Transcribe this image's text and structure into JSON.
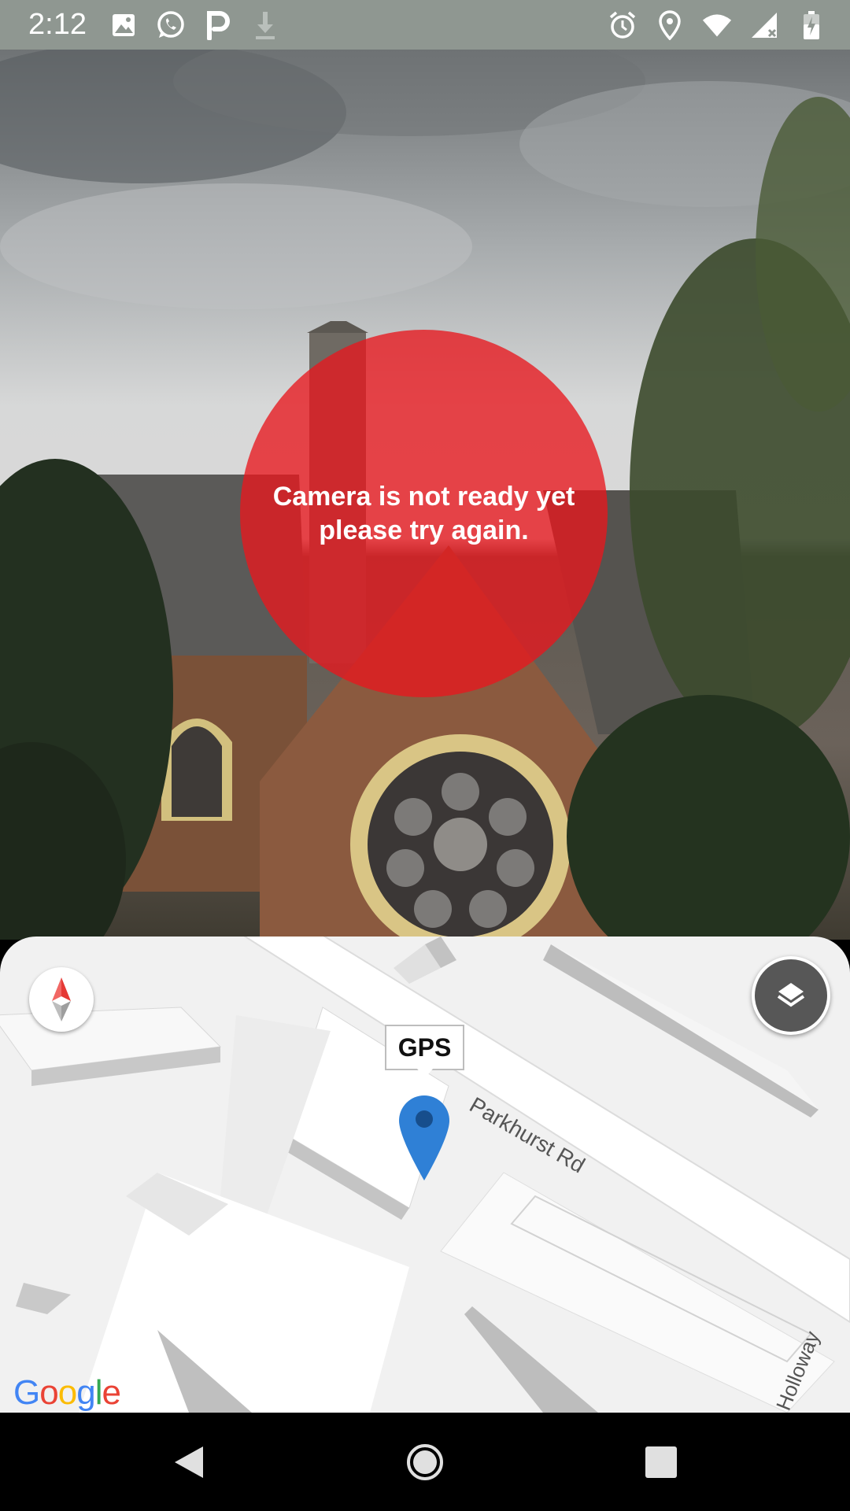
{
  "status_bar": {
    "time": "2:12",
    "left_icons": [
      "image-icon",
      "whatsapp-icon",
      "parking-p-icon",
      "download-icon"
    ],
    "right_icons": [
      "alarm-icon",
      "location-icon",
      "wifi-icon",
      "cellular-signal-icon",
      "battery-icon"
    ]
  },
  "camera": {
    "error_message_line1": "Camera is not ready yet",
    "error_message_line2": "please try again.",
    "overlay_color": "#e8171d"
  },
  "map": {
    "marker_label": "GPS",
    "street_name": "Parkhurst Rd",
    "street_name_partial": "Holloway",
    "attribution": "Google",
    "marker_color": "#2f80d6",
    "compass_icon": "compass-icon",
    "layers_icon": "layers-icon"
  },
  "nav_bar": {
    "buttons": [
      "back-icon",
      "home-icon",
      "recents-icon"
    ]
  }
}
